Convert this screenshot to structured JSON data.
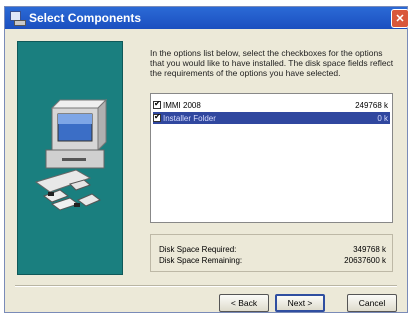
{
  "window": {
    "title": "Select Components",
    "close_glyph": "✕"
  },
  "instructions": "In the options list below, select the checkboxes for the options that you would like to have installed. The disk space fields reflect the requirements of the options you have selected.",
  "components": [
    {
      "name": "IMMI 2008",
      "size": "249768 k",
      "checked": true,
      "selected": false
    },
    {
      "name": "Installer Folder",
      "size": "0 k",
      "checked": true,
      "selected": true
    }
  ],
  "disk_space": {
    "required_label": "Disk Space Required:",
    "required_value": "349768 k",
    "remaining_label": "Disk Space Remaining:",
    "remaining_value": "20637600 k"
  },
  "buttons": {
    "back": "< Back",
    "next": "Next >",
    "cancel": "Cancel"
  },
  "colors": {
    "title_bar": "#1b4fbf",
    "art_background": "#1a7f7f",
    "selection": "#30479f"
  }
}
